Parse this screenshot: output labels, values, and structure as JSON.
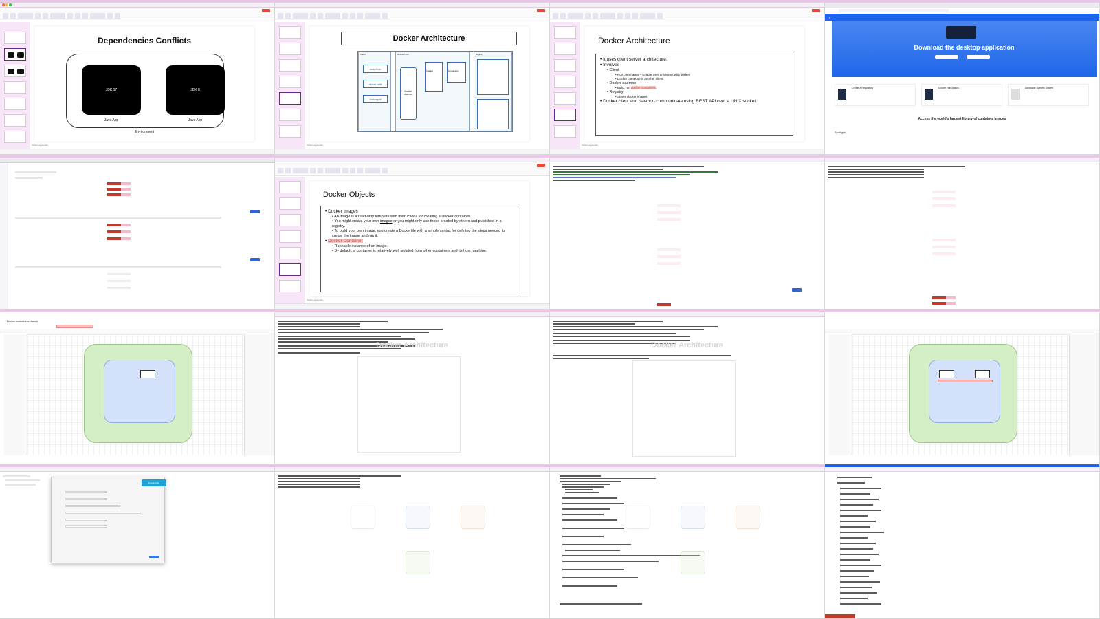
{
  "tile1": {
    "slide_title": "Dependencies Conflicts",
    "jdk_left": "JDK 17",
    "jdk_right": "JDK 8",
    "app_left": "Java App",
    "app_right": "Java App",
    "environment": "Environment",
    "notes": "Click to add notes"
  },
  "tile2": {
    "slide_title": "Docker Architecture",
    "col_client": "Client",
    "col_host": "Docker Host",
    "col_registry": "Registry",
    "cmd_run": "docker run",
    "cmd_build": "docker build",
    "cmd_pull": "docker pull",
    "daemon": "Docker daemon",
    "images": "Images",
    "containers": "Containers",
    "notes": "Click to add notes"
  },
  "tile3": {
    "slide_title": "Docker Architecture",
    "b1": "It uses client server architecture.",
    "b2": "Involves",
    "b2_1": "Client",
    "b2_1_1": "Run commands – Enable user to interact with docker.",
    "b2_1_2": "Docker compose is another client.",
    "b2_2": "Docker daemon",
    "b2_2_1_pre": "Build, run ",
    "b2_2_1_hl": "docker containers",
    "b2_2_1_post": ".",
    "b2_3": "Registry",
    "b2_3_1": "Stores docker images",
    "b3": "Docker client and daemon communicate using REST API over a UNIX socket.",
    "notes": "Click to add notes"
  },
  "tile4": {
    "hero_title": "Download the desktop application",
    "card1": "Create a Repository",
    "card2": "Docker Hub Basics",
    "card3": "Language Specific Guides",
    "library": "Access the world's largest library of container images",
    "spotlight": "Spotlight"
  },
  "tile6": {
    "slide_title": "Docker Objects",
    "b1": "Docker Images",
    "b1_1": "An image is a read-only template with instructions for creating a Docker container.",
    "b1_2_pre": "You might create your own ",
    "b1_2_link": "images",
    "b1_2_post": " or you might only use those created by others and published in a registry.",
    "b1_3": "To build your own image, you create a Dockerfile with a simple syntax for defining the steps needed to create the image and run it.",
    "b2": "Docker Container",
    "b2_1": "Runnable instance of an image.",
    "b2_2": "By default, a container is relatively well isolated from other containers and its host machine.",
    "notes": "Click to add notes"
  },
  "tile9": {
    "file_title": "Docker containers.drawio"
  },
  "tile10": {
    "watermark": "Docker Architecture"
  },
  "tile11": {
    "watermark": "Docker Architecture"
  },
  "tile13": {
    "badge": "PostgreSQL"
  },
  "colors": {
    "menu_bar": "#e8c7e8",
    "record": "#e64a3c",
    "hub_blue": "#1d63ed",
    "highlight": "#f6c6c2",
    "drawio_green": "#d4eec6",
    "drawio_blue": "#d3e1fa",
    "vuln_red": "#c0392b"
  },
  "icons": [
    "traffic-light-icons",
    "record-icon",
    "docker-whale-icon",
    "search-icon"
  ]
}
